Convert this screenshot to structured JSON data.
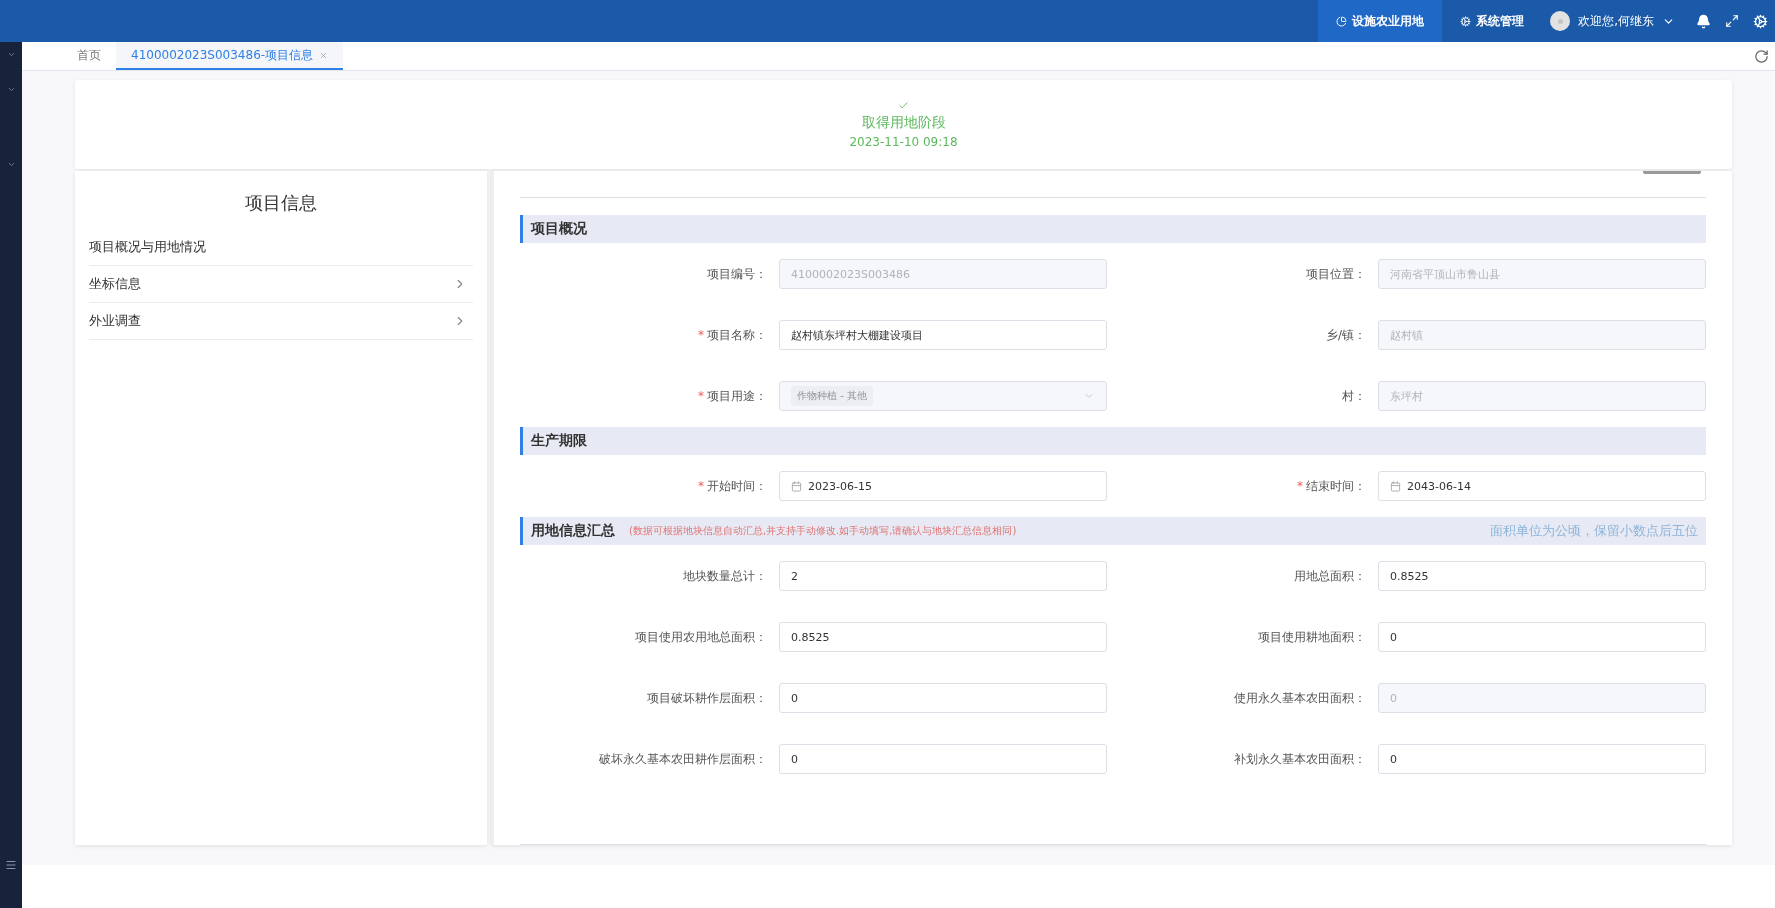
{
  "topbar": {
    "nav": [
      {
        "label": "设施农业用地",
        "selected": true
      },
      {
        "label": "系统管理",
        "selected": false
      }
    ],
    "user": {
      "greeting": "欢迎您,何继东"
    }
  },
  "tabs": [
    {
      "label": "首页",
      "selected": false,
      "closable": false
    },
    {
      "label": "4100002023S003486-项目信息",
      "selected": true,
      "closable": true
    }
  ],
  "stage": {
    "title": "取得用地阶段",
    "time": "2023-11-10 09:18",
    "done": true
  },
  "left_panel": {
    "title": "项目信息",
    "items": [
      {
        "label": "项目概况与用地情况",
        "expandable": false
      },
      {
        "label": "坐标信息",
        "expandable": true
      },
      {
        "label": "外业调查",
        "expandable": true
      }
    ]
  },
  "sections": [
    {
      "title": "项目概况",
      "fields": [
        {
          "label": "项目编号：",
          "kind": "input",
          "value": "4100002023S003486",
          "disabled": true
        },
        {
          "label": "项目位置：",
          "kind": "input",
          "value": "河南省平顶山市鲁山县",
          "disabled": true
        },
        {
          "required_mark": "*",
          "label": "项目名称：",
          "kind": "input",
          "value": "赵村镇东坪村大棚建设项目",
          "disabled": false
        },
        {
          "label": "乡/镇：",
          "kind": "input",
          "value": "赵村镇",
          "disabled": true
        },
        {
          "required_mark": "*",
          "label": "项目用途：",
          "kind": "select",
          "value": "作物种植 - 其他",
          "disabled": true
        },
        {
          "label": "村：",
          "kind": "input",
          "value": "东坪村",
          "disabled": true
        }
      ]
    },
    {
      "title": "生产期限",
      "fields": [
        {
          "required_mark": "*",
          "label": "开始时间：",
          "kind": "date",
          "value": "2023-06-15",
          "disabled": false
        },
        {
          "required_mark": "*",
          "label": "结束时间：",
          "kind": "date",
          "value": "2043-06-14",
          "disabled": false
        }
      ]
    },
    {
      "title": "用地信息汇总",
      "note": "(数据可根据地块信息自动汇总,并支持手动修改.如手动填写,请确认与地块汇总信息相同)",
      "hint": "面积单位为公顷，保留小数点后五位",
      "fields": [
        {
          "label": "地块数量总计：",
          "kind": "input",
          "value": "2",
          "disabled": false
        },
        {
          "label": "用地总面积：",
          "kind": "input",
          "value": "0.8525",
          "disabled": false
        },
        {
          "label": "项目使用农用地总面积：",
          "kind": "input",
          "value": "0.8525",
          "disabled": false
        },
        {
          "label": "项目使用耕地面积：",
          "kind": "input",
          "value": "0",
          "disabled": false
        },
        {
          "label": "项目破坏耕作层面积：",
          "kind": "input",
          "value": "0",
          "disabled": false
        },
        {
          "label": "使用永久基本农田面积：",
          "kind": "input",
          "value": "0",
          "disabled": true
        },
        {
          "label": "破坏永久基本农田耕作层面积：",
          "kind": "input",
          "value": "0",
          "disabled": false
        },
        {
          "label": "补划永久基本农田面积：",
          "kind": "input",
          "value": "0",
          "disabled": false
        }
      ]
    }
  ]
}
